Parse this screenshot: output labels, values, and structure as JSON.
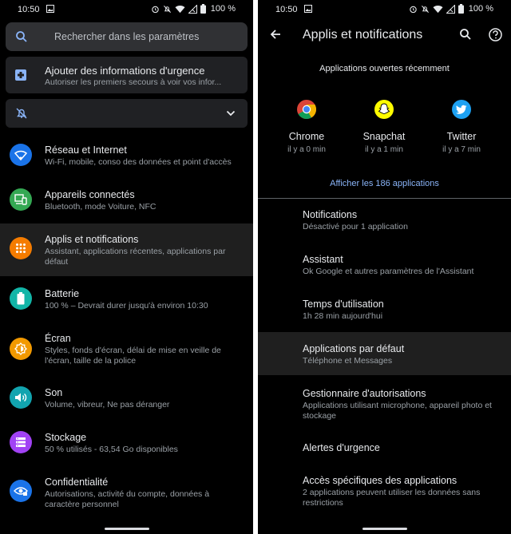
{
  "status": {
    "time": "10:50",
    "battery": "100 %"
  },
  "left": {
    "search_placeholder": "Rechercher dans les paramètres",
    "urgency": {
      "title": "Ajouter des informations d'urgence",
      "subtitle": "Autoriser les premiers secours à voir vos infor..."
    },
    "items": [
      {
        "title": "Réseau et Internet",
        "subtitle": "Wi-Fi, mobile, conso des données et point d'accès",
        "color": "#1a73e8"
      },
      {
        "title": "Appareils connectés",
        "subtitle": "Bluetooth, mode Voiture, NFC",
        "color": "#34a853"
      },
      {
        "title": "Applis et notifications",
        "subtitle": "Assistant, applications récentes, applications par défaut",
        "color": "#f57c00"
      },
      {
        "title": "Batterie",
        "subtitle": "100 % – Devrait durer jusqu'à environ 10:30",
        "color": "#12b5a7"
      },
      {
        "title": "Écran",
        "subtitle": "Styles, fonds d'écran, délai de mise en veille de l'écran, taille de la police",
        "color": "#f29900"
      },
      {
        "title": "Son",
        "subtitle": "Volume, vibreur, Ne pas déranger",
        "color": "#12a4af"
      },
      {
        "title": "Stockage",
        "subtitle": "50 % utilisés - 63,54 Go disponibles",
        "color": "#a142f4"
      },
      {
        "title": "Confidentialité",
        "subtitle": "Autorisations, activité du compte, données à caractère personnel",
        "color": "#1a73e8"
      }
    ]
  },
  "right": {
    "title": "Applis et notifications",
    "recent_title": "Applications ouvertes récemment",
    "apps": [
      {
        "name": "Chrome",
        "time": "il y a 0 min"
      },
      {
        "name": "Snapchat",
        "time": "il y a 1 min"
      },
      {
        "name": "Twitter",
        "time": "il y a 7 min"
      }
    ],
    "show_all": "Afficher les 186 applications",
    "items": [
      {
        "title": "Notifications",
        "subtitle": "Désactivé pour 1 application"
      },
      {
        "title": "Assistant",
        "subtitle": "Ok Google et autres paramètres de l'Assistant"
      },
      {
        "title": "Temps d'utilisation",
        "subtitle": "1h 28 min aujourd'hui"
      },
      {
        "title": "Applications par défaut",
        "subtitle": "Téléphone et Messages"
      },
      {
        "title": "Gestionnaire d'autorisations",
        "subtitle": "Applications utilisant microphone, appareil photo et stockage"
      },
      {
        "title": "Alertes d'urgence",
        "subtitle": ""
      },
      {
        "title": "Accès spécifiques des applications",
        "subtitle": "2 applications peuvent utiliser les données sans restrictions"
      }
    ]
  }
}
